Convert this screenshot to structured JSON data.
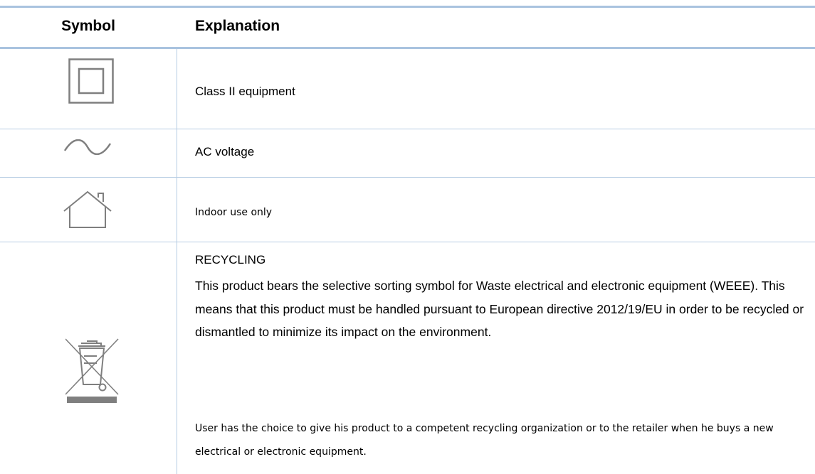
{
  "header": {
    "symbol": "Symbol",
    "explanation": "Explanation"
  },
  "rows": [
    {
      "icon": "class-ii-equipment-icon",
      "text": "Class II equipment"
    },
    {
      "icon": "ac-voltage-icon",
      "text": "AC voltage"
    },
    {
      "icon": "house-indoor-icon",
      "text": "Indoor use only"
    },
    {
      "icon": "crossed-out-wheelie-bin-icon",
      "title": "RECYCLING",
      "paragraph": "This product bears the selective sorting symbol for Waste electrical and electronic equipment (WEEE). This means that this product must be handled pursuant to European directive 2012/19/EU in order to be recycled or dismantled to minimize its impact on the environment.",
      "note": "User has the choice to give his product to a competent recycling organization or to the retailer when he buys a new electrical or electronic equipment."
    }
  ],
  "colors": {
    "rule": "#a9c3df",
    "icon_stroke": "#7f7f7f"
  }
}
